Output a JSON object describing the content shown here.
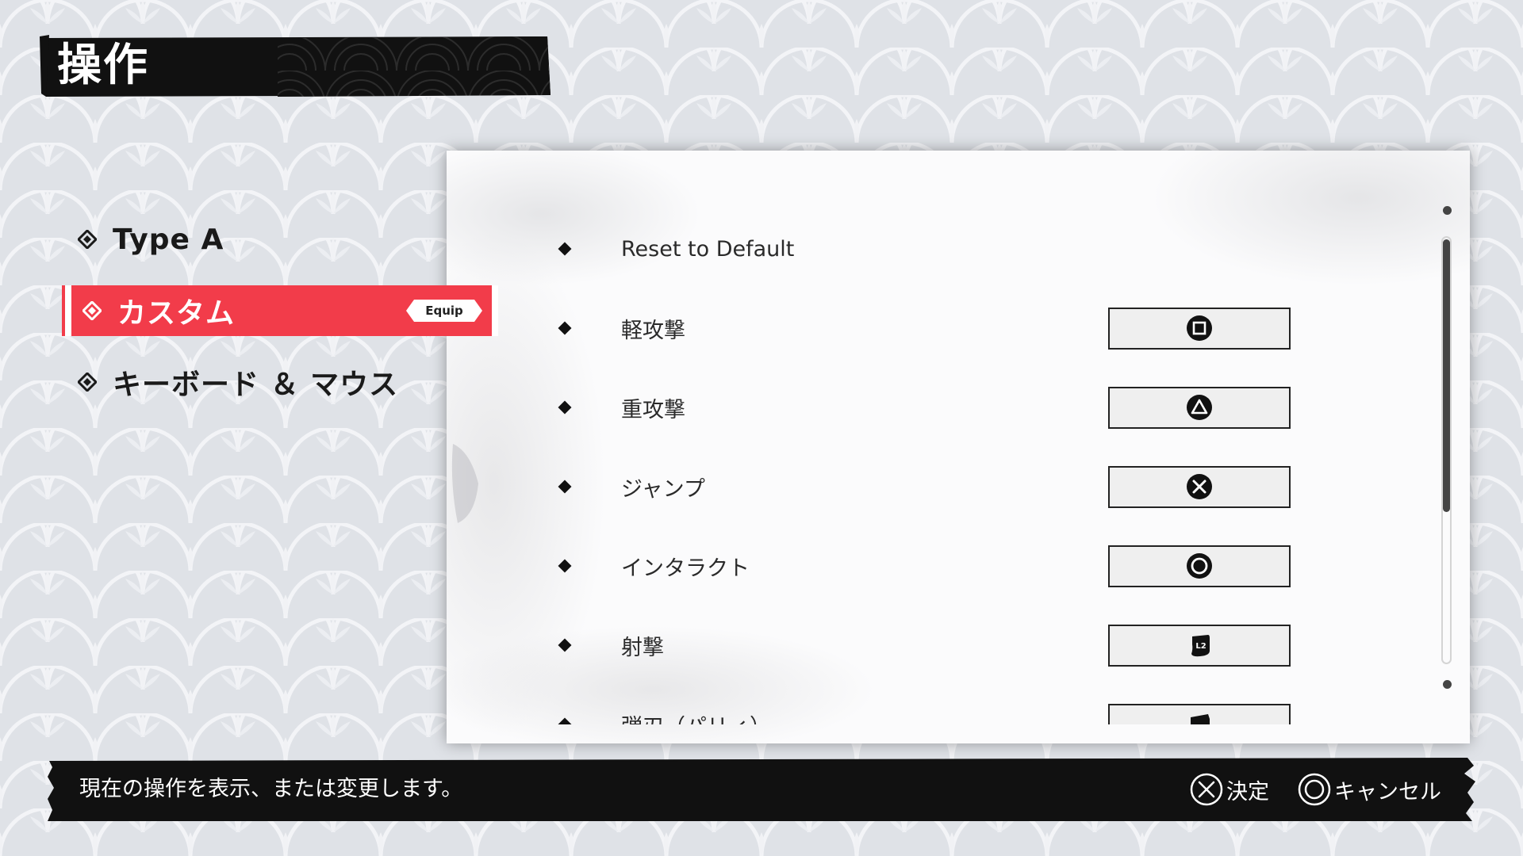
{
  "screen": {
    "title": "操作"
  },
  "menu": {
    "items": [
      {
        "label": "Type A",
        "selected": false
      },
      {
        "label": "カスタム",
        "selected": true,
        "badge": "Equip"
      },
      {
        "label": "キーボード ＆ マウス",
        "selected": false
      }
    ]
  },
  "bindings": {
    "rows": [
      {
        "label": "Reset to Default",
        "button": null
      },
      {
        "label": "軽攻撃",
        "button": "square-button-icon"
      },
      {
        "label": "重攻撃",
        "button": "triangle-button-icon"
      },
      {
        "label": "ジャンプ",
        "button": "cross-button-icon"
      },
      {
        "label": "インタラクト",
        "button": "circle-button-icon"
      },
      {
        "label": "射撃",
        "button": "l2-trigger-icon",
        "button_text": "L2"
      },
      {
        "label": "弾刃（パリィ）",
        "button": "trigger-icon"
      }
    ]
  },
  "footer": {
    "help": "現在の操作を表示、または変更します。",
    "confirm_label": "決定",
    "cancel_label": "キャンセル"
  },
  "colors": {
    "accent": "#f23c4a",
    "banner": "#111111",
    "background": "#dfe2e7"
  }
}
